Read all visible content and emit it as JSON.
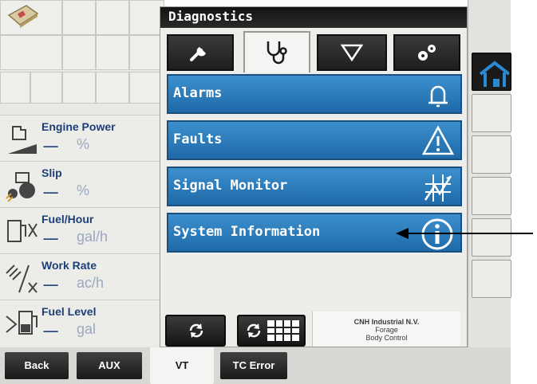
{
  "diagnostics": {
    "title": "Diagnostics",
    "tabs": [
      {
        "icon": "wrench-icon"
      },
      {
        "icon": "stethoscope-icon",
        "active": true
      },
      {
        "icon": "triangle-down-icon"
      },
      {
        "icon": "gears-icon"
      }
    ],
    "menu": [
      {
        "label": "Alarms",
        "icon": "bell-icon"
      },
      {
        "label": "Faults",
        "icon": "warning-icon"
      },
      {
        "label": "Signal Monitor",
        "icon": "signal-graph-icon"
      },
      {
        "label": "System Information",
        "icon": "info-icon"
      }
    ],
    "brand": {
      "line1": "CNH Industrial N.V.",
      "line2": "Forage",
      "line3": "Body Control"
    }
  },
  "widgets": [
    {
      "title": "Engine Power",
      "value": "-----",
      "unit": "%",
      "icon": "engine-power-icon"
    },
    {
      "title": "Slip",
      "value": "-----",
      "unit": "%",
      "icon": "tractor-slip-icon"
    },
    {
      "title": "Fuel/Hour",
      "value": "-----",
      "unit": "gal/h",
      "icon": "fuel-hour-icon"
    },
    {
      "title": "Work Rate",
      "value": "-----",
      "unit": "ac/h",
      "icon": "work-rate-icon"
    },
    {
      "title": "Fuel Level",
      "value": "-----",
      "unit": "gal",
      "icon": "fuel-level-icon"
    }
  ],
  "bottom_bar": {
    "tabs": [
      {
        "label": "Back"
      },
      {
        "label": "AUX"
      },
      {
        "label": "VT",
        "active": true
      },
      {
        "label": "TC Error"
      }
    ]
  },
  "colors": {
    "menu_blue": "#2a7bbd",
    "title_blue": "#1d3f77",
    "tab_dark": "#1e1e1e"
  }
}
